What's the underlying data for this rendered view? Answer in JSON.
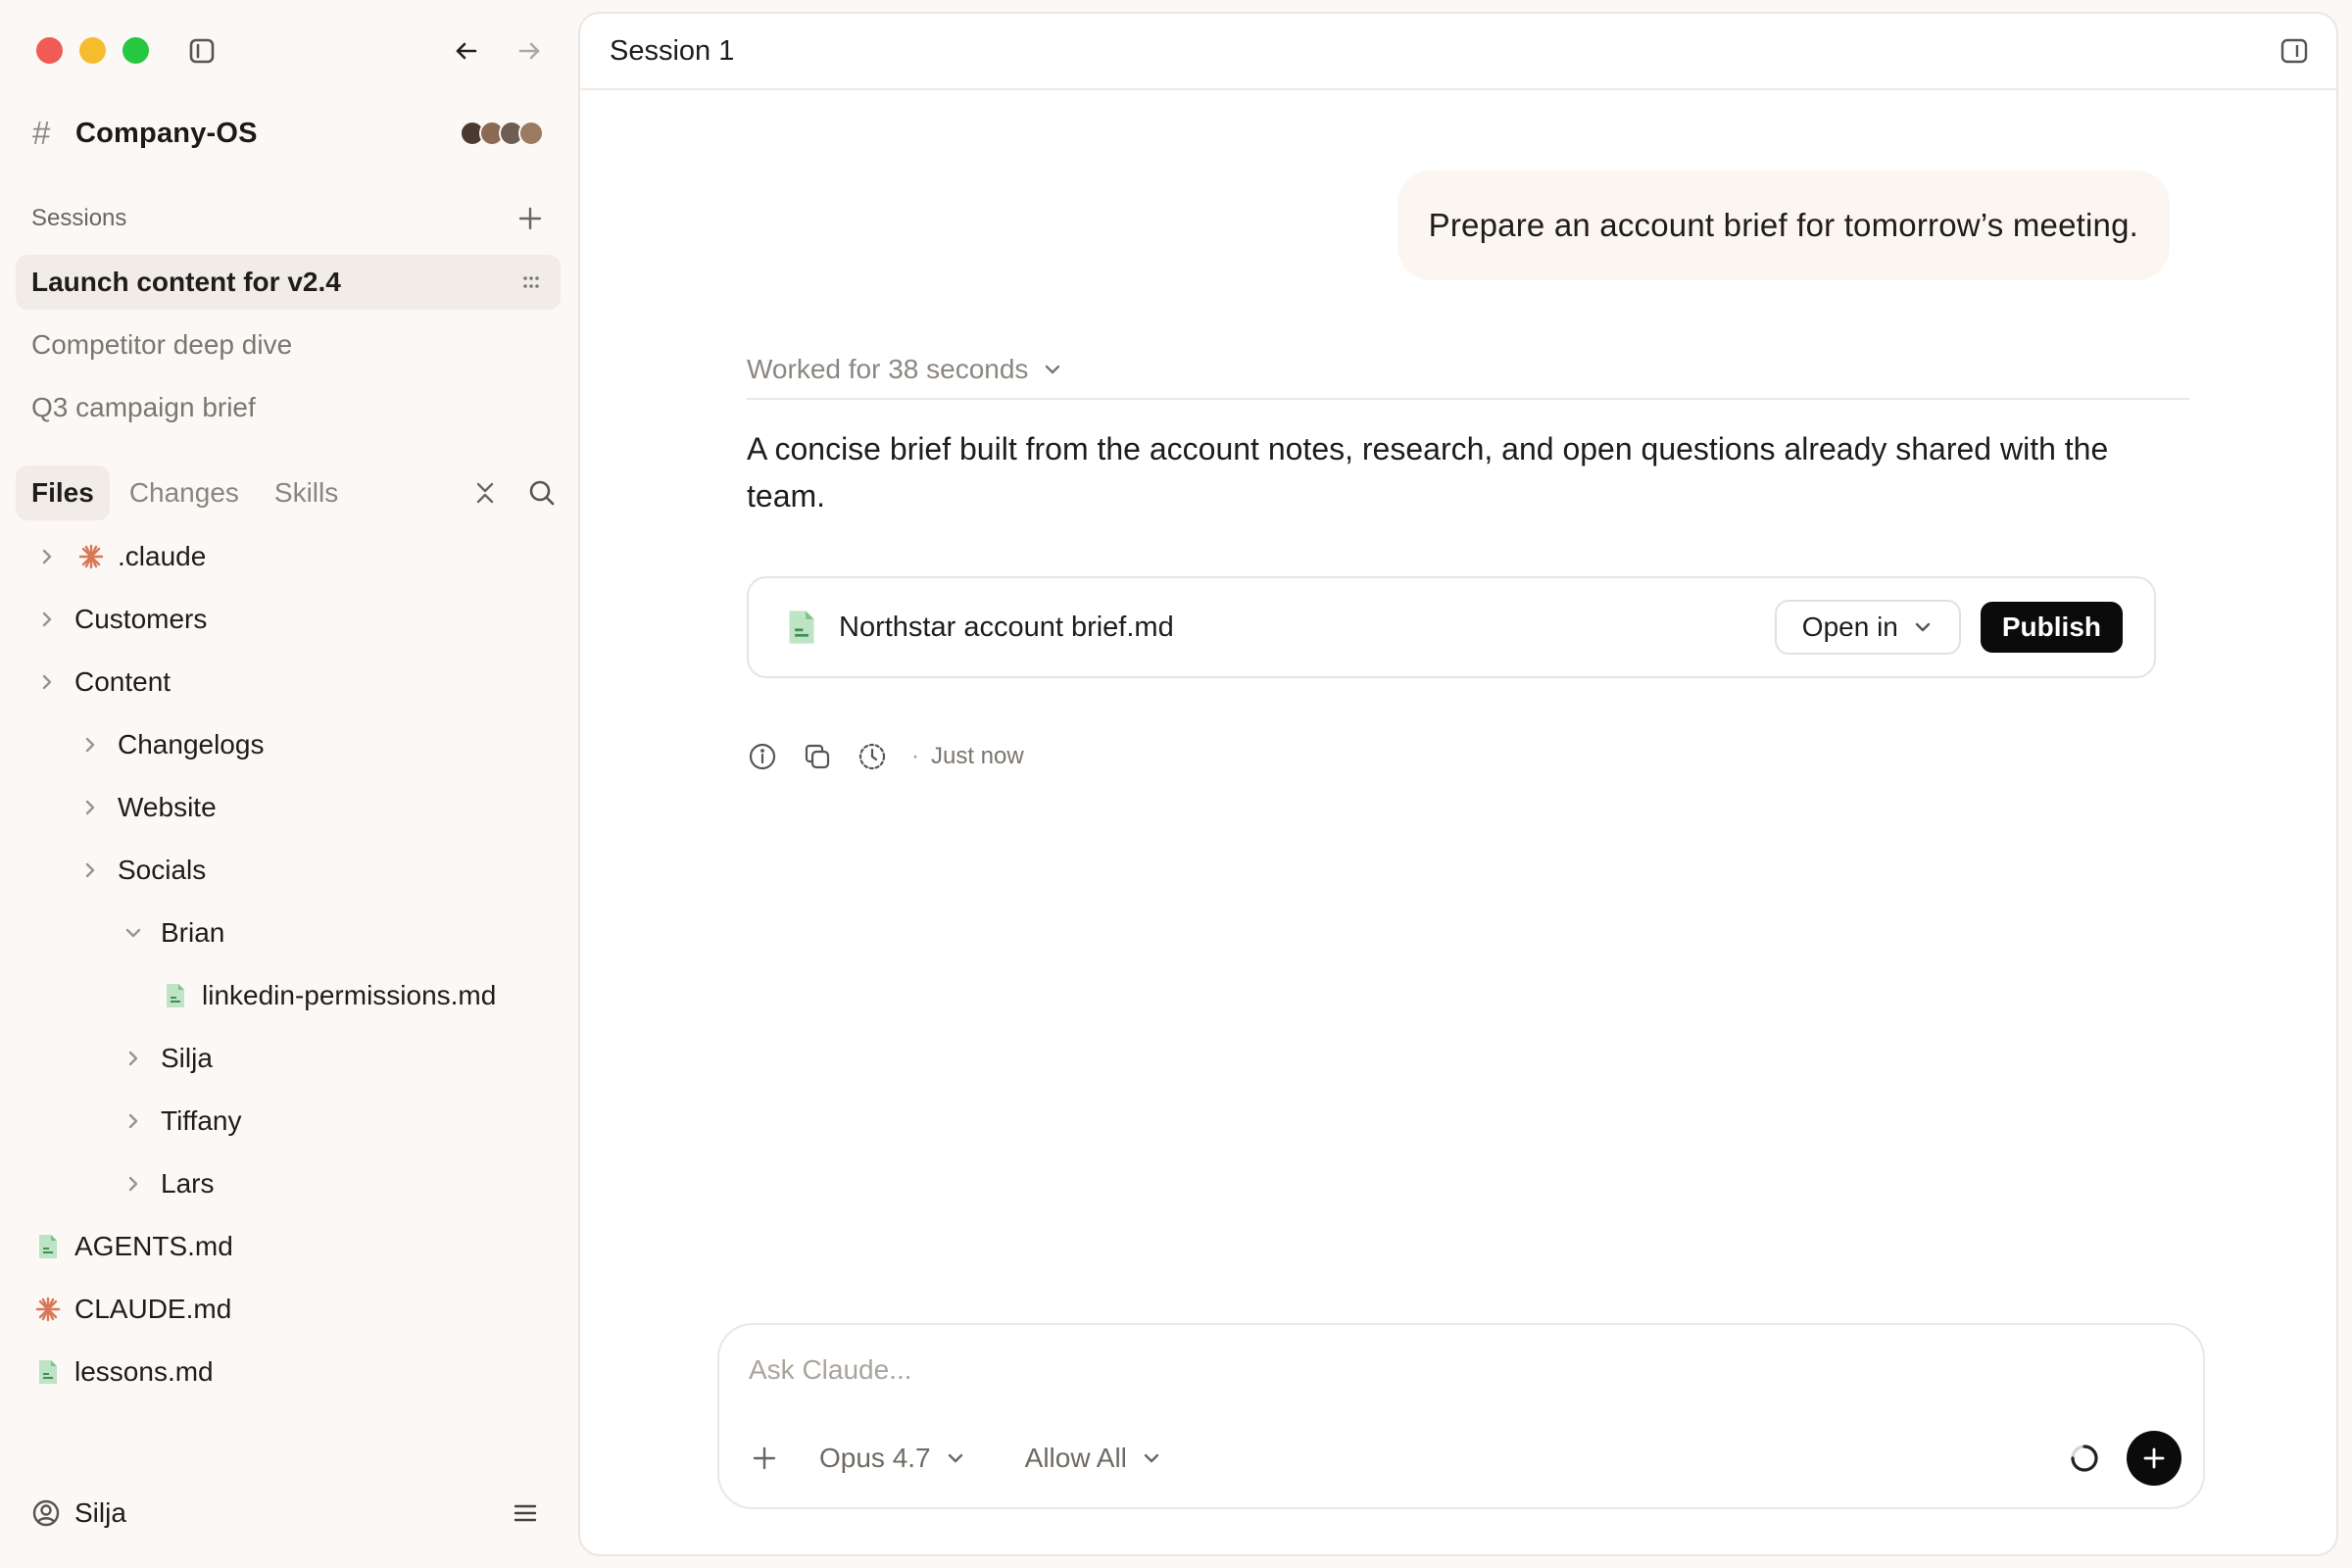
{
  "sidebar": {
    "workspace": {
      "name": "Company-OS"
    },
    "sessions": {
      "header": "Sessions",
      "items": [
        {
          "label": "Launch content for v2.4",
          "active": true
        },
        {
          "label": "Competitor deep dive",
          "active": false
        },
        {
          "label": "Q3 campaign brief",
          "active": false
        }
      ]
    },
    "files_tabs": [
      {
        "label": "Files",
        "active": true
      },
      {
        "label": "Changes",
        "active": false
      },
      {
        "label": "Skills",
        "active": false
      }
    ],
    "tree": [
      {
        "label": ".claude",
        "icon": "claude-asterisk-icon",
        "chevron": "right"
      },
      {
        "label": "Customers",
        "chevron": "right"
      },
      {
        "label": "Content",
        "chevron": "right"
      },
      {
        "label": "Changelogs",
        "chevron": "right"
      },
      {
        "label": "Website",
        "chevron": "right"
      },
      {
        "label": "Socials",
        "chevron": "right"
      },
      {
        "label": "Brian",
        "chevron": "down"
      },
      {
        "label": "linkedin-permissions.md",
        "icon": "markdown-file-icon"
      },
      {
        "label": "Silja",
        "chevron": "right"
      },
      {
        "label": "Tiffany",
        "chevron": "right"
      },
      {
        "label": "Lars",
        "chevron": "right"
      },
      {
        "label": "AGENTS.md",
        "icon": "markdown-file-icon"
      },
      {
        "label": "CLAUDE.md",
        "icon": "claude-asterisk-icon"
      },
      {
        "label": "lessons.md",
        "icon": "markdown-file-icon"
      }
    ],
    "user": {
      "name": "Silja"
    }
  },
  "main": {
    "title": "Session 1",
    "user_message": "Prepare an account brief for tomorrow’s meeting.",
    "worked_for": "Worked for 38 seconds",
    "answer": "A concise brief built from the account notes, research, and open questions already shared with the team.",
    "file_card": {
      "filename": "Northstar account brief.md",
      "open_in_label": "Open in",
      "publish_label": "Publish"
    },
    "meta": {
      "separator": "·",
      "timestamp": "Just now"
    },
    "composer": {
      "placeholder": "Ask Claude...",
      "model": "Opus 4.7",
      "permissions": "Allow All"
    }
  },
  "colors": {
    "sidebar_bg": "#fcf8f5",
    "active_item_bg": "#f1ece7",
    "claude_orange": "#d97757",
    "markdown_green": "#7cc48a",
    "primary_button": "#0b0b0b"
  }
}
